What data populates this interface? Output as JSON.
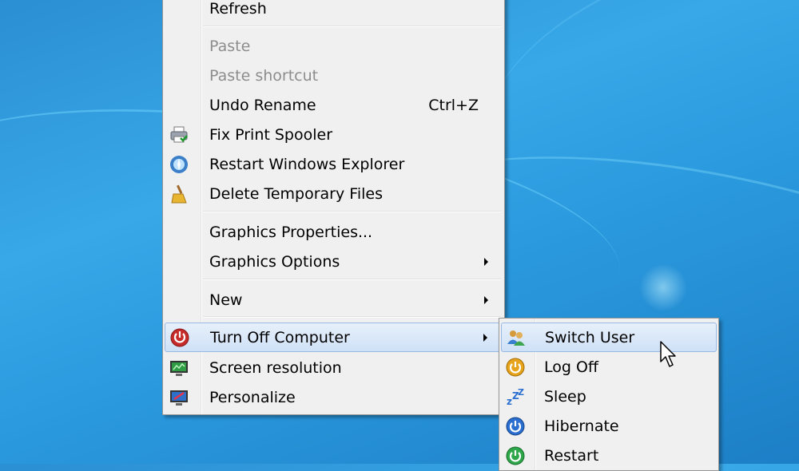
{
  "context_menu": {
    "items": [
      {
        "label": "Refresh"
      },
      {
        "label": "Paste"
      },
      {
        "label": "Paste shortcut"
      },
      {
        "label": "Undo Rename",
        "shortcut": "Ctrl+Z"
      },
      {
        "label": "Fix Print Spooler"
      },
      {
        "label": "Restart Windows Explorer"
      },
      {
        "label": "Delete Temporary Files"
      },
      {
        "label": "Graphics Properties..."
      },
      {
        "label": "Graphics Options"
      },
      {
        "label": "New"
      },
      {
        "label": "Turn Off Computer"
      },
      {
        "label": "Screen resolution"
      },
      {
        "label": "Personalize"
      }
    ]
  },
  "submenu": {
    "items": [
      {
        "label": "Switch User"
      },
      {
        "label": "Log Off"
      },
      {
        "label": "Sleep"
      },
      {
        "label": "Hibernate"
      },
      {
        "label": "Restart"
      }
    ]
  },
  "colors": {
    "desktop_blue": "#2a98dd",
    "menu_bg": "#f0f0f0",
    "highlight": "#cfe1f7",
    "disabled_text": "#8d8d8d"
  }
}
